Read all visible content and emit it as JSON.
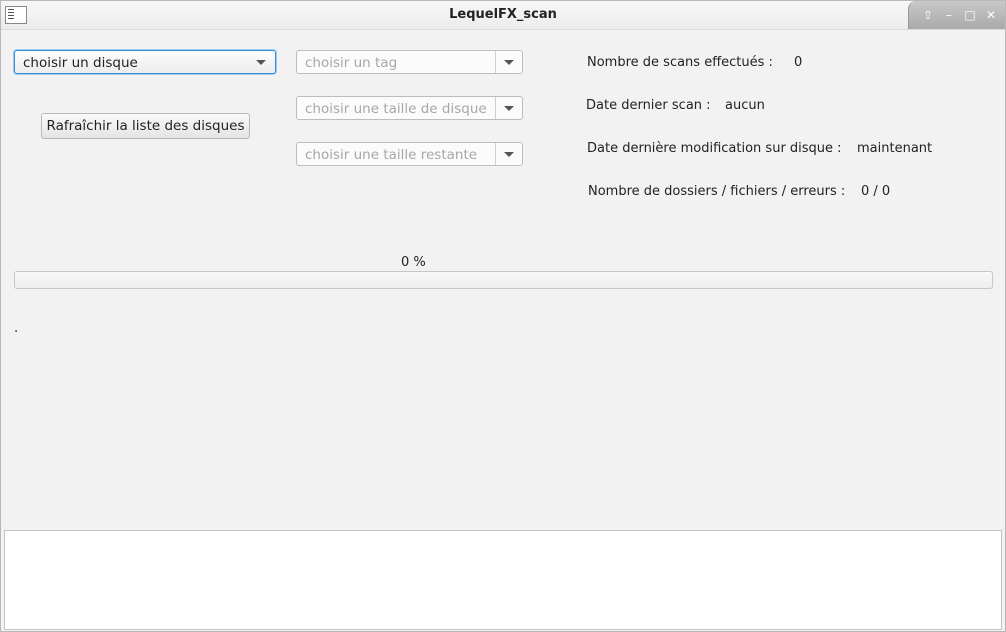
{
  "window": {
    "title": "LequelFX_scan",
    "controls": [
      "up-icon",
      "minimize-icon",
      "maximize-icon",
      "close-icon"
    ]
  },
  "combos": {
    "disk": "choisir un disque",
    "tag": "choisir un tag",
    "size": "choisir une taille de disque",
    "remaining": "choisir une taille restante"
  },
  "buttons": {
    "refresh": "Rafraîchir la liste des disques"
  },
  "stats": {
    "scan_count_label": "Nombre de scans effectués :",
    "scan_count_value": "0",
    "last_scan_label": "Date dernier scan :",
    "last_scan_value": "aucun",
    "last_mod_label": "Date dernière modification sur disque :",
    "last_mod_value": "maintenant",
    "counts_label": "Nombre de dossiers / fichiers / erreurs :",
    "counts_value": "0 / 0"
  },
  "progress": {
    "label": "0 %",
    "fraction": 0
  },
  "status_text": ".",
  "colors": {
    "accent": "#3a8ed8",
    "background": "#f2f2f2"
  }
}
